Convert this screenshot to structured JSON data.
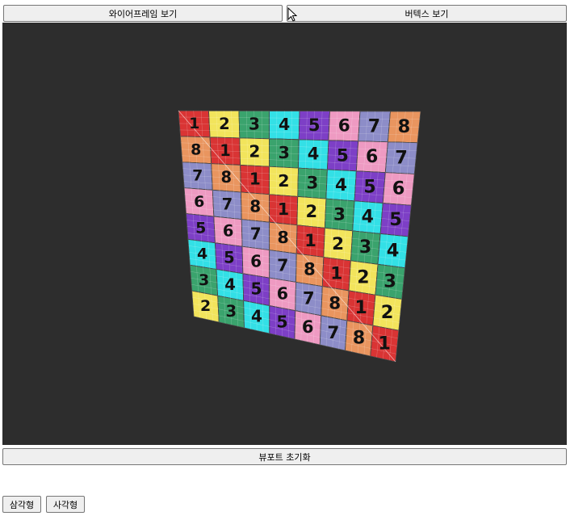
{
  "toolbar": {
    "wireframe_label": "와이어프레임 보기",
    "vertex_label": "버텍스 보기"
  },
  "viewport": {
    "background": "#2d2d2d",
    "grid": {
      "rows": [
        [
          1,
          2,
          3,
          4,
          5,
          6,
          7,
          8
        ],
        [
          8,
          1,
          2,
          3,
          4,
          5,
          6,
          7
        ],
        [
          7,
          8,
          1,
          2,
          3,
          4,
          5,
          6
        ],
        [
          6,
          7,
          8,
          1,
          2,
          3,
          4,
          5
        ],
        [
          5,
          6,
          7,
          8,
          1,
          2,
          3,
          4
        ],
        [
          4,
          5,
          6,
          7,
          8,
          1,
          2,
          3
        ],
        [
          3,
          4,
          5,
          6,
          7,
          8,
          1,
          2
        ],
        [
          2,
          3,
          4,
          5,
          6,
          7,
          8,
          1
        ]
      ],
      "colors": {
        "1": "#d93434",
        "2": "#f2e45c",
        "3": "#3aa36d",
        "4": "#33e0e6",
        "5": "#7d3fc6",
        "6": "#ee9ac2",
        "7": "#8d8dc8",
        "8": "#e9955f"
      }
    }
  },
  "footer": {
    "reset_label": "뷰포트 초기화",
    "triangle_label": "삼각형",
    "rect_label": "사각형"
  }
}
